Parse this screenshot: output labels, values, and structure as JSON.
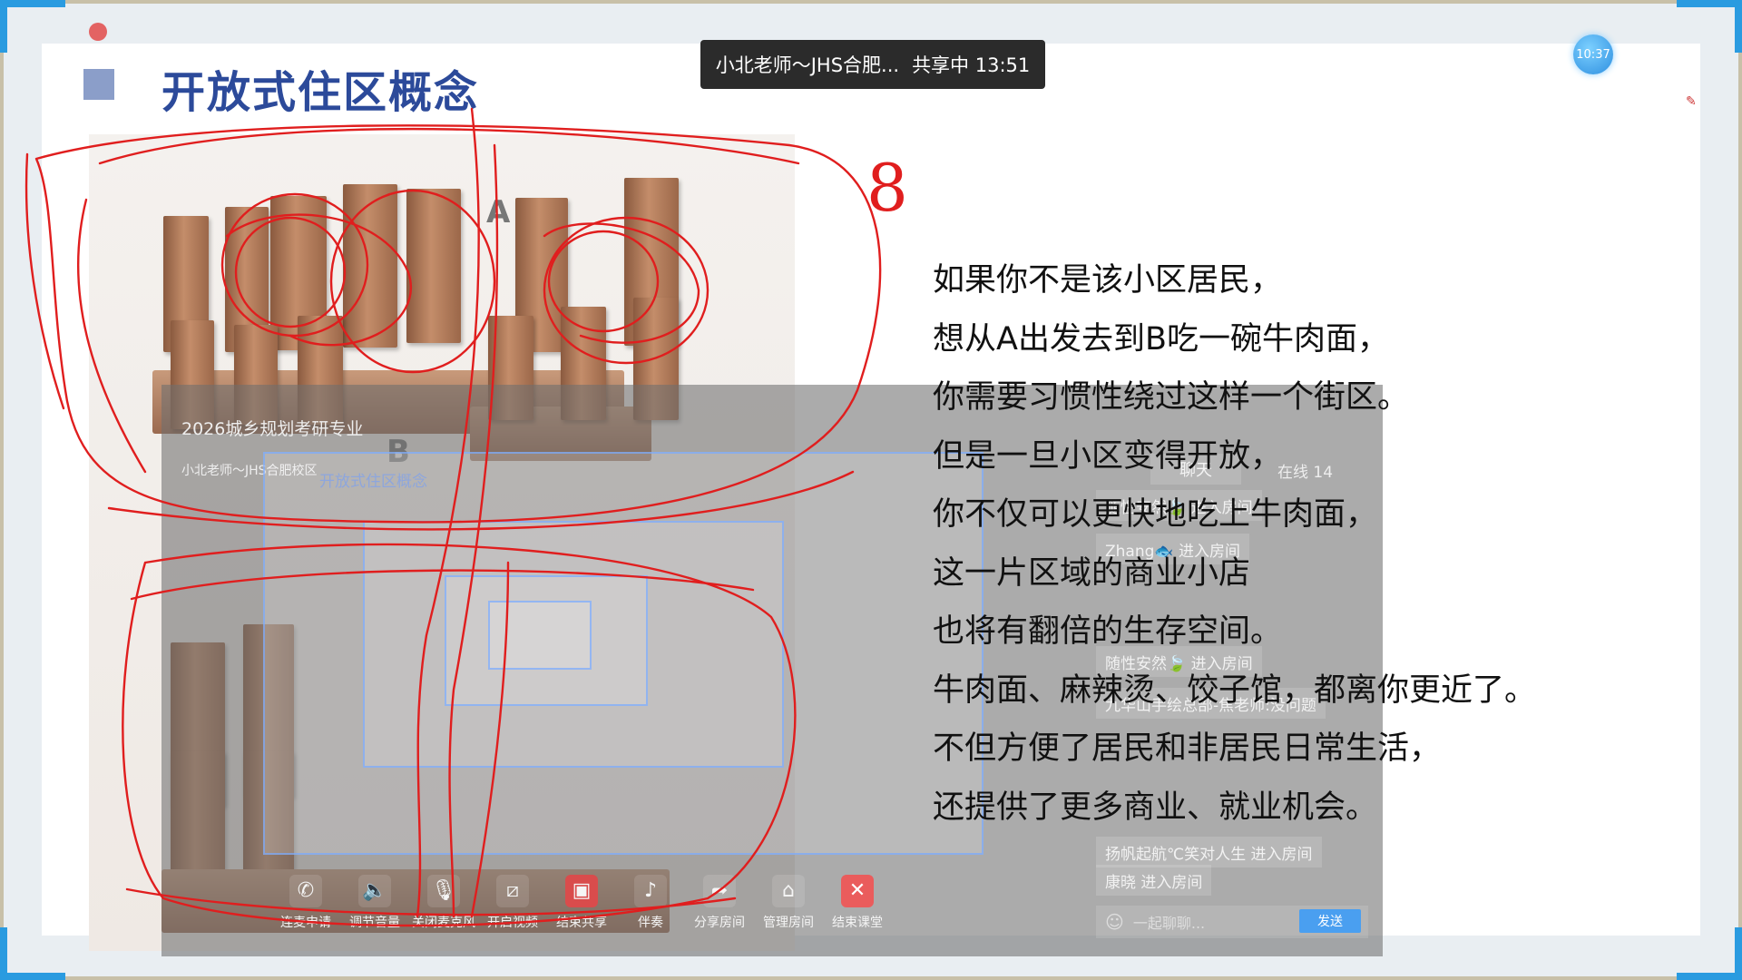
{
  "slide": {
    "title": "开放式住区概念",
    "lines": [
      "如果你不是该小区居民，",
      "想从A出发去到B吃一碗牛肉面，",
      "你需要习惯性绕过这样一个街区。",
      "但是一旦小区变得开放，",
      "你不仅可以更快地吃上牛肉面，",
      "这一片区域的商业小店",
      "也将有翻倍的生存空间。",
      "牛肉面、麻辣烫、饺子馆，都离你更近了。",
      "不但方便了居民和非居民日常生活，",
      "还提供了更多商业、就业机会。"
    ],
    "label_a": "A",
    "label_b": "B",
    "annotation_number": "8"
  },
  "share_bar": {
    "presenter": "小北老师～JHS合肥...",
    "status": "共享中 13:51"
  },
  "clock": {
    "time": "10:37"
  },
  "overlay": {
    "course_name": "2026城乡规划考研专业",
    "presenter_full": "小北老师～JHS合肥校区",
    "nested_title": "开放式住区概念"
  },
  "chat": {
    "title": "聊天",
    "online": "在线 14",
    "messages": [
      "随性安然🍃 进入房间",
      "Zhang🐟 进入房间",
      "随性安然🍃 进入房间",
      "九华山手绘总部-焦老师:没问题",
      "扬帆起航℃笑对人生 进入房间",
      "康晓 进入房间"
    ],
    "input_placeholder": "一起聊聊...",
    "send_label": "发送"
  },
  "toolbar": {
    "items": [
      {
        "label": "连麦申请",
        "icon": "phone-icon"
      },
      {
        "label": "调节音量",
        "icon": "speaker-icon"
      },
      {
        "label": "关闭麦克风",
        "icon": "microphone-icon"
      },
      {
        "label": "开启视频",
        "icon": "video-off-icon"
      },
      {
        "label": "结束共享",
        "icon": "stop-share-icon"
      },
      {
        "label": "伴奏",
        "icon": "music-icon"
      },
      {
        "label": "分享房间",
        "icon": "share-icon"
      },
      {
        "label": "管理房间",
        "icon": "home-settings-icon"
      },
      {
        "label": "结束课堂",
        "icon": "close-icon"
      }
    ]
  },
  "colors": {
    "title": "#2c4a9a",
    "annotation": "#e01e1e",
    "accent": "#2a9be0",
    "end_button": "#ea5c5c"
  }
}
